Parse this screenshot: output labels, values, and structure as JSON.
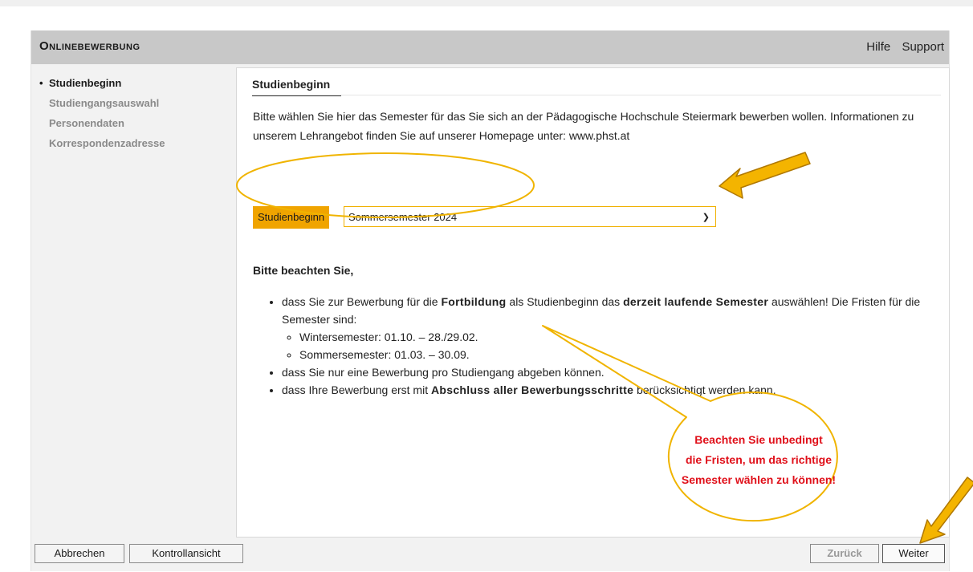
{
  "app": {
    "title": "Onlinebewerbung"
  },
  "header": {
    "help": "Hilfe",
    "support": "Support"
  },
  "sidebar": {
    "items": [
      {
        "label": "Studienbeginn",
        "active": true
      },
      {
        "label": "Studiengangsauswahl",
        "active": false
      },
      {
        "label": "Personendaten",
        "active": false
      },
      {
        "label": "Korrespondenzadresse",
        "active": false
      }
    ]
  },
  "main": {
    "tab": "Studienbeginn",
    "intro_text": "Bitte wählen Sie hier das Semester für das Sie sich an der Pädagogische Hochschule Steiermark bewerben wollen. Informationen zu unserem Lehrangebot finden Sie auf unserer Homepage unter: ",
    "intro_link": "www.phst.at",
    "field": {
      "label": "Studienbeginn",
      "selected": "Sommersemester 2024"
    },
    "note_title": "Bitte beachten Sie,",
    "b1_pre": "dass Sie zur Bewerbung für die ",
    "b1_bold1": "Fortbildung",
    "b1_mid": " als Studienbeginn das ",
    "b1_bold2": "derzeit laufende Semester",
    "b1_post": " auswählen! Die Fristen für die Semester sind:",
    "sub1": "Wintersemester: 01.10. – 28./29.02.",
    "sub2": "Sommersemester: 01.03. – 30.09.",
    "b2": "dass Sie nur eine Bewerbung pro Studiengang abgeben können.",
    "b3_pre": "dass Ihre Bewerbung erst mit ",
    "b3_bold": "Abschluss aller Bewerbungsschritte",
    "b3_post": " berücksichtigt werden kann."
  },
  "buttons": {
    "cancel": "Abbrechen",
    "control": "Kontrollansicht",
    "back": "Zurück",
    "next": "Weiter"
  },
  "annotation": {
    "line1": "Beachten Sie unbedingt",
    "line2": "die Fristen, um das richtige",
    "line3": "Semester wählen zu können!",
    "color": "#e0101a",
    "highlight_color": "#f0b400"
  }
}
